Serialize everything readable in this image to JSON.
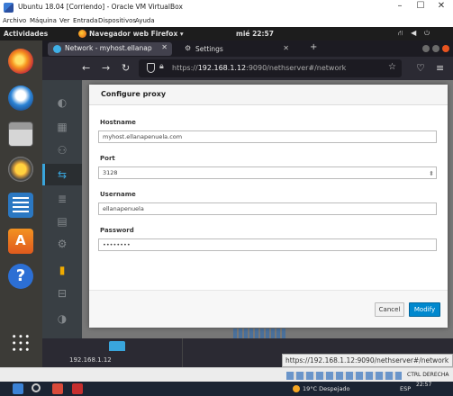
{
  "vbox": {
    "title": "Ubuntu 18.04 [Corriendo] - Oracle VM VirtualBox",
    "menu": [
      "Archivo",
      "Máquina",
      "Ver",
      "Entrada",
      "Dispositivos",
      "Ayuda"
    ],
    "hostkey": "CTRL DERECHA"
  },
  "ubuntu": {
    "activities": "Actividades",
    "app_menu": "Navegador web Firefox ▾",
    "clock": "mié 22:57"
  },
  "firefox": {
    "tab_active": "Network - myhost.ellanap",
    "tab_settings": "Settings",
    "url_host": "192.168.1.12",
    "url_prefix": "https://",
    "url_rest": ":9090/nethserver#/network"
  },
  "dialog": {
    "title": "Configure proxy",
    "hostname_label": "Hostname",
    "hostname_value": "myhost.ellanapenuela.com",
    "port_label": "Port",
    "port_value": "3128",
    "username_label": "Username",
    "username_value": "ellanapenuela",
    "password_label": "Password",
    "password_value": "••••••••",
    "cancel": "Cancel",
    "modify": "Modify"
  },
  "cockpit": {
    "host_ip": "192.168.1.12"
  },
  "status_link": "https://192.168.1.12:9090/nethserver#/network",
  "taskbar": {
    "weather": "19°C  Despejado",
    "lang": "ESP",
    "time": "22:57"
  }
}
